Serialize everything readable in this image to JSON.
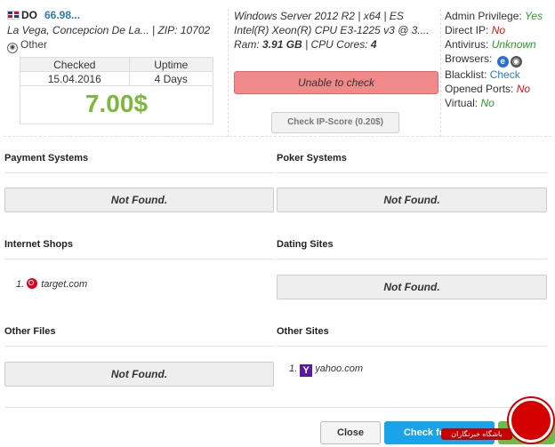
{
  "host": {
    "country_code": "DO",
    "ip": "66.98...",
    "location": "La Vega, Concepcion De La...",
    "zip_label": "ZIP:",
    "zip": "10702",
    "type": "Other"
  },
  "stats": {
    "checked_label": "Checked",
    "uptime_label": "Uptime",
    "checked": "15.04.2016",
    "uptime": "4 Days",
    "price": "7.00$"
  },
  "system": {
    "os": "Windows Server 2012 R2 | x64 | ES",
    "cpu": "Intel(R) Xeon(R) CPU E3-1225 v3 @ 3....",
    "ram_label": "Ram:",
    "ram": "3.91 GB",
    "cores_label": "| CPU Cores:",
    "cores": "4",
    "unable_label": "Unable to check",
    "ipscore_label": "Check IP-Score (0.20$)"
  },
  "props": {
    "admin_label": "Admin Privilege:",
    "admin": "Yes",
    "direct_label": "Direct IP:",
    "direct": "No",
    "antivirus_label": "Antivirus:",
    "antivirus": "Unknown",
    "browsers_label": "Browsers:",
    "blacklist_label": "Blacklist:",
    "blacklist": "Check",
    "ports_label": "Opened Ports:",
    "ports": "No",
    "virtual_label": "Virtual:",
    "virtual": "No"
  },
  "sections": {
    "payment": {
      "title": "Payment Systems",
      "status": "Not Found."
    },
    "poker": {
      "title": "Poker Systems",
      "status": "Not Found."
    },
    "shops": {
      "title": "Internet Shops",
      "items": [
        {
          "num": "1.",
          "name": "target.com"
        }
      ]
    },
    "dating": {
      "title": "Dating Sites",
      "status": "Not Found."
    },
    "files": {
      "title": "Other Files",
      "status": "Not Found."
    },
    "sites": {
      "title": "Other Sites",
      "items": [
        {
          "num": "1.",
          "name": "yahoo.com"
        }
      ]
    }
  },
  "footer": {
    "close_label": "Close",
    "check_label": "Check for Bla..."
  },
  "watermark": {
    "text": "باشگاه خبرنگاران"
  },
  "colors": {
    "price": "#7cb83b",
    "accent": "#1aa3e8",
    "danger_btn": "#f08a8a"
  }
}
